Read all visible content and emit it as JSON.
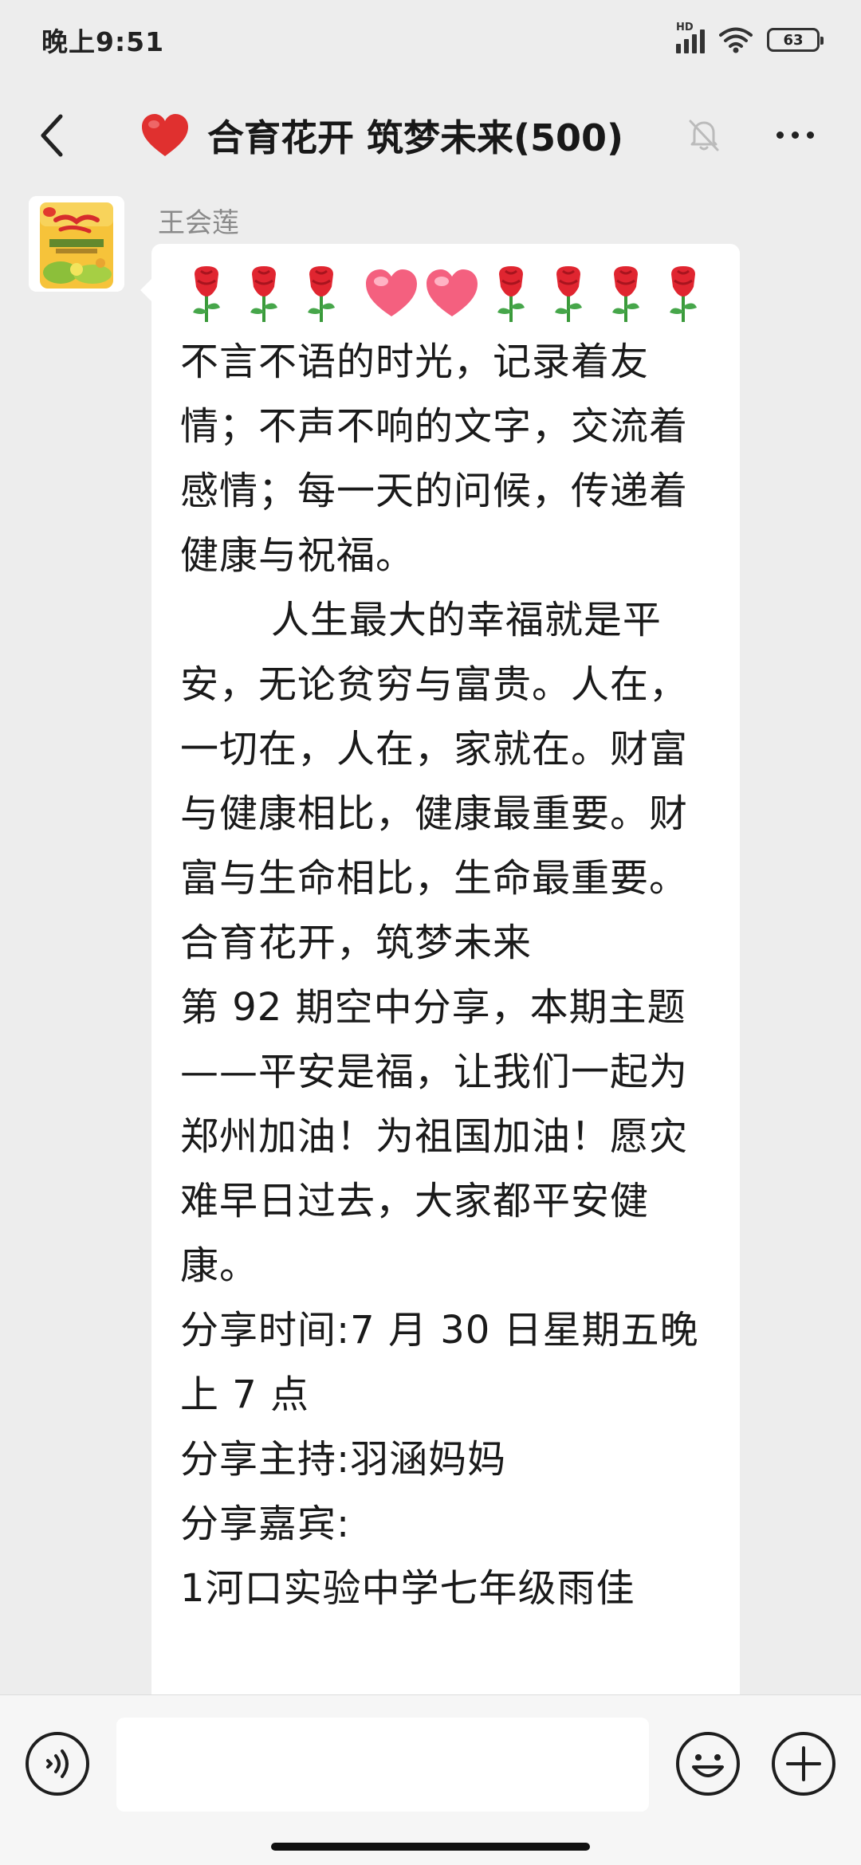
{
  "status_bar": {
    "time": "晚上9:51",
    "network_label": "HD",
    "battery": "63"
  },
  "header": {
    "title": "合育花开 筑梦未来(500)",
    "icons": [
      "back-arrow-icon",
      "red-heart-icon",
      "mute-bell-icon",
      "more-dots-icon"
    ]
  },
  "message": {
    "sender": "王会莲",
    "emoji_line": [
      "rose",
      "rose",
      "rose",
      "pink-heart",
      "pink-heart",
      "rose",
      "rose",
      "rose",
      "rose"
    ],
    "paragraphs": [
      "不言不语的时光，记录着友情；不声不响的文字，交流着感情；每一天的问候，传递着健康与祝福。",
      "       人生最大的幸福就是平安，无论贫穷与富贵。人在，一切在，人在，家就在。财富与健康相比，健康最重要。财富与生命相比，生命最重要。",
      "合育花开，筑梦未来",
      "第 92 期空中分享，本期主题——平安是福，让我们一起为郑州加油！为祖国加油！愿灾难早日过去，大家都平安健康。",
      "分享时间:7 月 30 日星期五晚上 7 点",
      "分享主持:羽涵妈妈",
      "分享嘉宾:",
      "1河口实验中学七年级雨佳"
    ]
  },
  "input_bar": {
    "value": "",
    "icons": [
      "voice-icon",
      "emoji-icon",
      "plus-icon"
    ]
  },
  "colors": {
    "background": "#ededed",
    "bubble": "#ffffff",
    "accent_red": "#e0302f"
  }
}
